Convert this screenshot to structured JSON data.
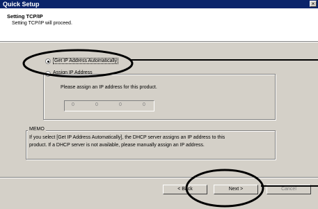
{
  "window": {
    "title": "Quick Setup",
    "close_label": "×"
  },
  "header": {
    "title": "Setting TCP/IP",
    "subtitle": "Setting TCP/IP will proceed."
  },
  "options": {
    "auto_label": "Get IP Address Automatically",
    "manual_label": "Assign IP Address",
    "selected": "auto"
  },
  "assign": {
    "prompt": "Please assign an IP address for this product.",
    "ip_octets": [
      "0",
      "0",
      "0",
      "0"
    ]
  },
  "memo": {
    "legend": "MEMO",
    "line1": "If you select [Get IP Address Automatically], the DHCP server assigns an IP address to this",
    "line2": "product. If a DHCP server is not available, please manually assign an IP address."
  },
  "buttons": {
    "back": "< Back",
    "next": "Next >",
    "cancel": "Cancel"
  },
  "colors": {
    "title_bar": "#0a246a",
    "dialog_face": "#d4d0c8"
  }
}
